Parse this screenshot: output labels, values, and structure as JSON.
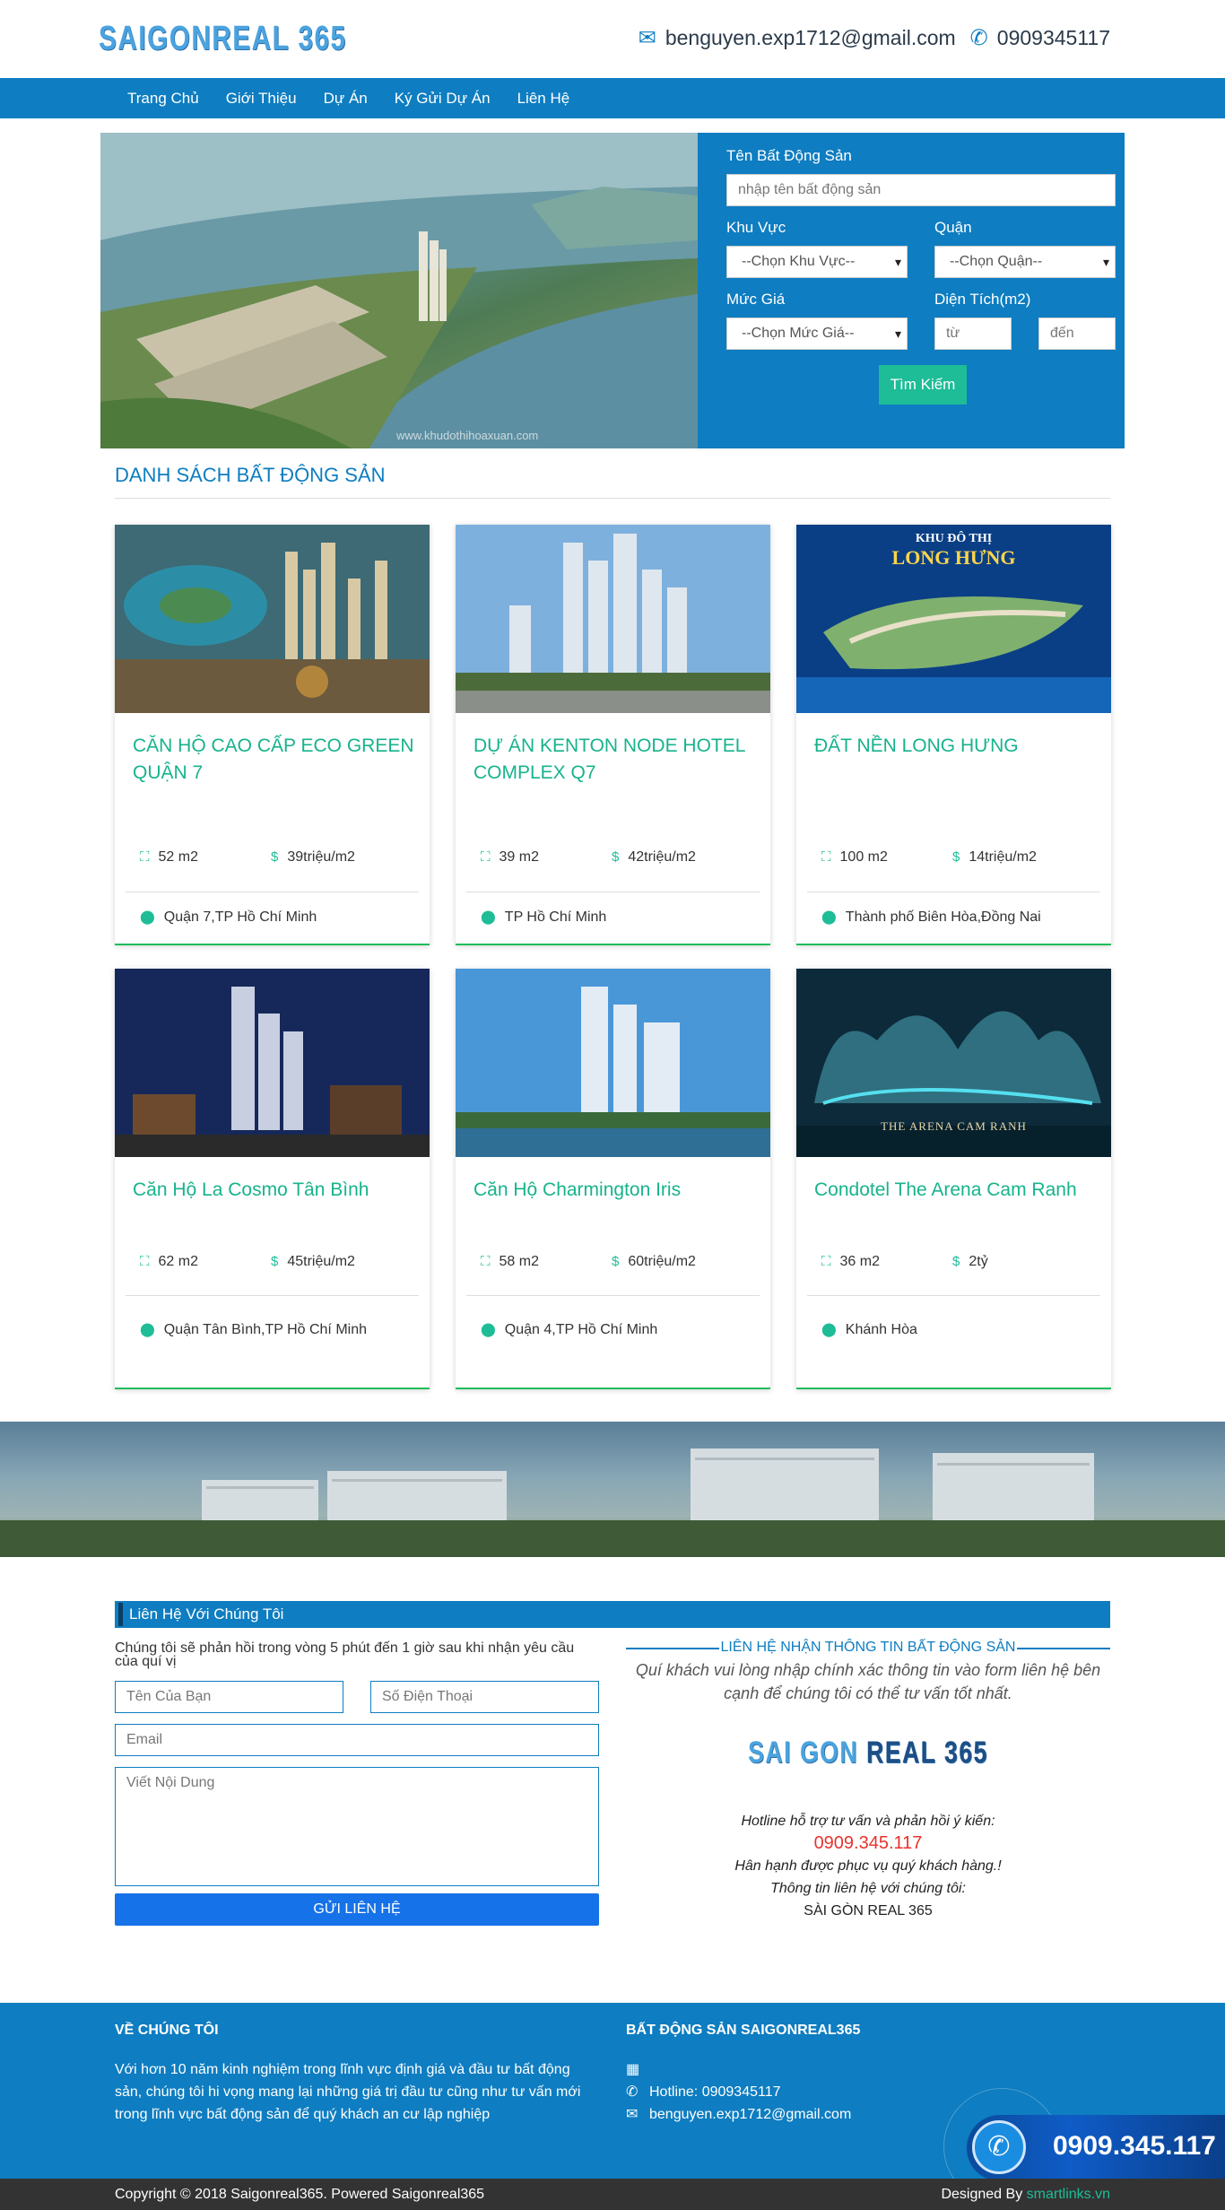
{
  "header": {
    "logo_text": "SAIGONREAL 365",
    "email": "benguyen.exp1712@gmail.com",
    "phone": "0909345117"
  },
  "nav": [
    "Trang Chủ",
    "Giới Thiệu",
    "Dự Án",
    "Ký Gửi Dự Án",
    "Liên Hệ"
  ],
  "search": {
    "name_label": "Tên Bất Động Sản",
    "name_placeholder": "nhập tên bất động sản",
    "region_label": "Khu Vực",
    "region_select": "--Chọn Khu Vực--",
    "district_label": "Quận",
    "district_select": "--Chọn Quận--",
    "price_label": "Mức Giá",
    "price_select": "--Chọn Mức Giá--",
    "area_label": "Diện Tích(m2)",
    "area_from": "từ",
    "area_to": "đến",
    "button": "Tìm Kiếm",
    "watermark": "www.khudothihoaxuan.com"
  },
  "list_title": "DANH SÁCH BẤT ĐỘNG SẢN",
  "listings": [
    {
      "name": "CĂN HỘ CAO CẤP ECO GREEN QUẬN 7",
      "area": "52 m2",
      "price": "39triệu/m2",
      "location": "Quận 7,TP Hồ Chí Minh"
    },
    {
      "name": "DỰ ÁN KENTON NODE HOTEL COMPLEX Q7",
      "area": "39 m2",
      "price": "42triệu/m2",
      "location": "TP Hồ Chí Minh"
    },
    {
      "name": "ĐẤT NỀN LONG HƯNG",
      "area": "100 m2",
      "price": "14triệu/m2",
      "location": "Thành phố Biên Hòa,Đồng Nai",
      "img_title": "KHU ĐÔ THỊ",
      "img_sub": "LONG HƯNG"
    },
    {
      "name": "Căn Hộ La Cosmo Tân Bình",
      "area": "62 m2",
      "price": "45triệu/m2",
      "location": "Quận Tân Bình,TP Hồ Chí Minh"
    },
    {
      "name": "Căn Hộ Charmington Iris",
      "area": "58 m2",
      "price": "60triệu/m2",
      "location": "Quận 4,TP Hồ Chí Minh"
    },
    {
      "name": "Condotel The Arena Cam Ranh",
      "area": "36 m2",
      "price": "2tỷ",
      "location": "Khánh Hòa",
      "img_title": "THE ARENA CAM RANH"
    }
  ],
  "contact": {
    "bar_title": "Liên Hệ Với Chúng Tôi",
    "desc": "Chúng tôi sẽ phản hồi trong vòng 5 phút đến 1 giờ sau khi nhận yêu cầu của quí vị",
    "name_ph": "Tên Của Bạn",
    "phone_ph": "Số Điện Thoại",
    "email_ph": "Email",
    "content_ph": "Viết Nội Dung",
    "send": "GỬI LIÊN HỆ",
    "right_head": "LIÊN HỆ NHẬN THÔNG TIN BẤT ĐỘNG SẢN",
    "right_sub": "Quí khách vui lòng nhập chính xác thông tin vào form liên hệ bên cạnh để chúng tôi có thể tư vấn tốt nhất.",
    "brand_a": "SAI GON",
    "brand_b": "REAL 365",
    "l1": "Hotline hỗ trợ tư vấn và phản hồi ý kiến:",
    "hotline": "0909.345.117",
    "l2": "Hân hạnh được phục vụ quý khách hàng.!",
    "l3": "Thông tin liên hệ với chúng tôi:",
    "l4": "SÀI GÒN REAL 365"
  },
  "footer": {
    "about_h": "VỀ CHÚNG TÔI",
    "about": "Với hơn 10 năm kinh nghiệm trong lĩnh vực định giá và đầu tư bất động sản, chúng tôi hi vọng mang lại những giá trị đầu tư cũng như tư vấn mới trong lĩnh vực bất động sản để quý khách an cư lập nghiệp",
    "right_h": "BẤT ĐỘNG SẢN SAIGONREAL365",
    "hotline": "Hotline: 0909345117",
    "email": "benguyen.exp1712@gmail.com",
    "copyright": "Copyright © 2018 Saigonreal365. Powered Saigonreal365",
    "designed_by": "Designed By",
    "designer": "smartlinks.vn",
    "float_hotline": "0909.345.117"
  }
}
